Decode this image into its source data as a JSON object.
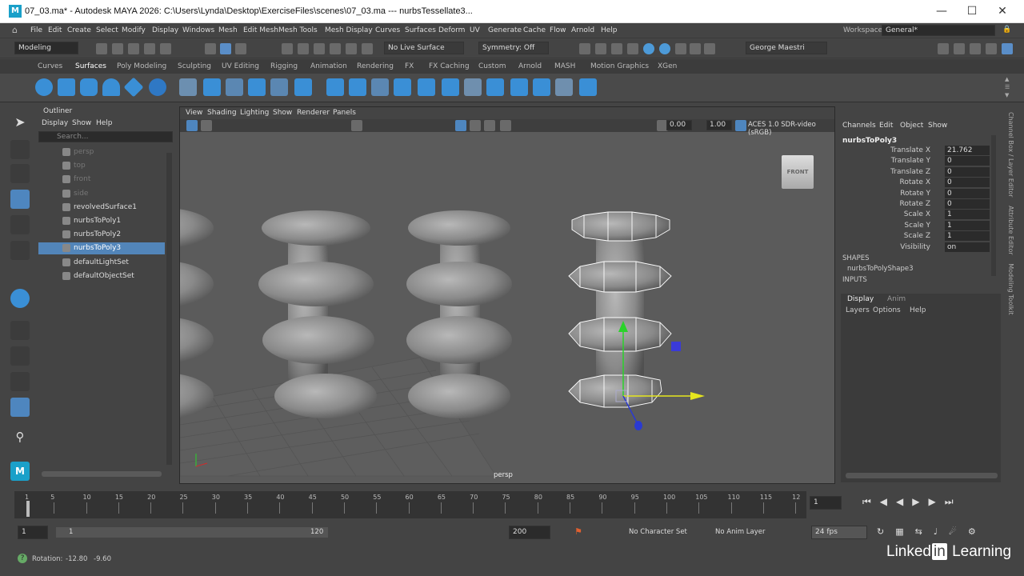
{
  "title": "07_03.ma* - Autodesk MAYA 2026: C:\\Users\\Lynda\\Desktop\\ExerciseFiles\\scenes\\07_03.ma --- nurbsTessellate3...",
  "app_logo": "M",
  "menus": [
    "File",
    "Edit",
    "Create",
    "Select",
    "Modify",
    "Display",
    "Windows",
    "Mesh",
    "Edit Mesh",
    "Mesh Tools",
    "Mesh Display",
    "Curves",
    "Surfaces",
    "Deform",
    "UV",
    "Generate",
    "Cache",
    "Flow",
    "Arnold",
    "Help"
  ],
  "workspace_label": "Workspace:",
  "workspace_value": "General*",
  "mode": "Modeling",
  "live_surface": "No Live Surface",
  "symmetry": "Symmetry: Off",
  "user": "George Maestri",
  "shelf_tabs": [
    "Curves",
    "Surfaces",
    "Poly Modeling",
    "Sculpting",
    "UV Editing",
    "Rigging",
    "Animation",
    "Rendering",
    "FX",
    "FX Caching",
    "Custom",
    "Arnold",
    "MASH",
    "Motion Graphics",
    "XGen"
  ],
  "active_shelf_tab": "Surfaces",
  "outliner": {
    "title": "Outliner",
    "menu": [
      "Display",
      "Show",
      "Help"
    ],
    "search_placeholder": "Search...",
    "items": [
      {
        "label": "persp",
        "dim": true
      },
      {
        "label": "top",
        "dim": true
      },
      {
        "label": "front",
        "dim": true
      },
      {
        "label": "side",
        "dim": true
      },
      {
        "label": "revolvedSurface1",
        "dim": false
      },
      {
        "label": "nurbsToPoly1",
        "dim": false
      },
      {
        "label": "nurbsToPoly2",
        "dim": false
      },
      {
        "label": "nurbsToPoly3",
        "dim": false,
        "selected": true
      },
      {
        "label": "defaultLightSet",
        "dim": false
      },
      {
        "label": "defaultObjectSet",
        "dim": false
      }
    ]
  },
  "viewport": {
    "menu": [
      "View",
      "Shading",
      "Lighting",
      "Show",
      "Renderer",
      "Panels"
    ],
    "val1": "0.00",
    "val2": "1.00",
    "colorspace": "ACES 1.0 SDR-video (sRGB)",
    "camera": "persp",
    "viewcube": "FRONT"
  },
  "channel_box": {
    "menu": [
      "Channels",
      "Edit",
      "Object",
      "Show"
    ],
    "object": "nurbsToPoly3",
    "attributes": [
      {
        "label": "Translate X",
        "value": "21.762"
      },
      {
        "label": "Translate Y",
        "value": "0"
      },
      {
        "label": "Translate Z",
        "value": "0"
      },
      {
        "label": "Rotate X",
        "value": "0"
      },
      {
        "label": "Rotate Y",
        "value": "0"
      },
      {
        "label": "Rotate Z",
        "value": "0"
      },
      {
        "label": "Scale X",
        "value": "1"
      },
      {
        "label": "Scale Y",
        "value": "1"
      },
      {
        "label": "Scale Z",
        "value": "1"
      },
      {
        "label": "Visibility",
        "value": "on"
      }
    ],
    "shapes_label": "SHAPES",
    "shape": "nurbsToPolyShape3",
    "inputs_label": "INPUTS",
    "layer_tabs": [
      "Display",
      "Anim"
    ],
    "layer_menu": [
      "Layers",
      "Options",
      "Help"
    ],
    "side_tabs": [
      "Channel Box / Layer Editor",
      "Attribute Editor",
      "Modeling Toolkit"
    ]
  },
  "timeline": {
    "ticks": [
      "1",
      "5",
      "10",
      "15",
      "20",
      "25",
      "30",
      "35",
      "40",
      "45",
      "50",
      "55",
      "60",
      "65",
      "70",
      "75",
      "80",
      "85",
      "90",
      "95",
      "100",
      "105",
      "110",
      "115",
      "12"
    ],
    "current": "1"
  },
  "range": {
    "start": "1",
    "inner_start": "1",
    "inner_end": "120",
    "end": "200",
    "char_set": "No Character Set",
    "anim_layer": "No Anim Layer",
    "fps": "24 fps"
  },
  "status": {
    "label": "Rotation:",
    "v1": "-12.80",
    "v2": "-9.60"
  },
  "watermark_a": "Linked",
  "watermark_b": "in",
  "watermark_c": " Learning"
}
